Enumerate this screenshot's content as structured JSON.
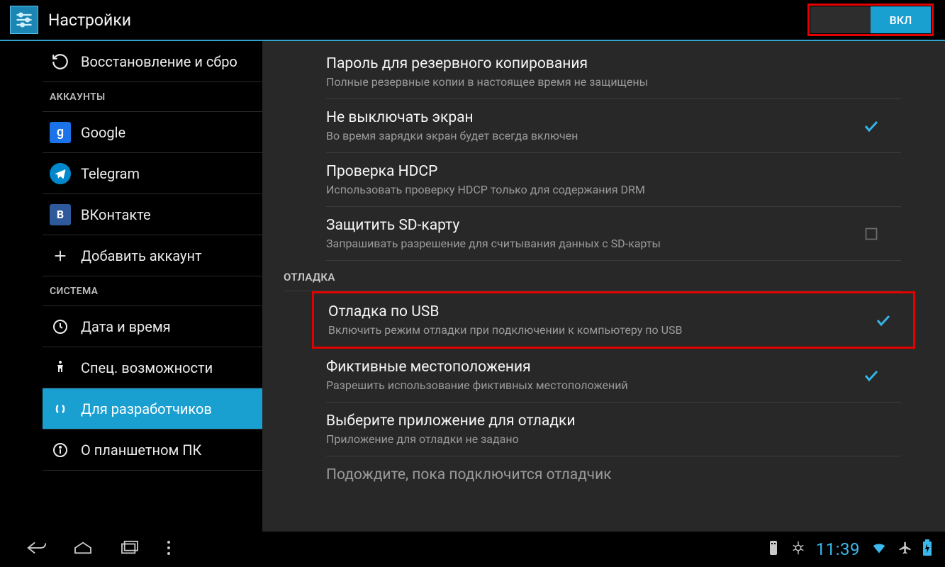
{
  "header": {
    "title": "Настройки",
    "toggle_label": "ВКЛ"
  },
  "sidebar": {
    "items": {
      "recovery": {
        "label": "Восстановление и сбро"
      },
      "google": {
        "label": "Google"
      },
      "telegram": {
        "label": "Telegram"
      },
      "vk": {
        "label": "ВКонтакте"
      },
      "add_account": {
        "label": "Добавить аккаунт"
      },
      "datetime": {
        "label": "Дата и время"
      },
      "accessibility": {
        "label": "Спец. возможности"
      },
      "developer": {
        "label": "Для разработчиков"
      },
      "about": {
        "label": "О планшетном ПК"
      }
    },
    "cat_accounts": "АККАУНТЫ",
    "cat_system": "СИСТЕМА"
  },
  "main": {
    "sec_debug": "ОТЛАДКА",
    "opt_backup_pw": {
      "title": "Пароль для резервного копирования",
      "sub": "Полные резервные копии в настоящее время не защищены"
    },
    "opt_stay_awake": {
      "title": "Не выключать экран",
      "sub": "Во время зарядки экран будет всегда включен"
    },
    "opt_hdcp": {
      "title": "Проверка HDCP",
      "sub": "Использовать проверку HDCP только для содержания DRM"
    },
    "opt_sd": {
      "title": "Защитить SD-карту",
      "sub": "Запрашивать разрешение для считывания данных с SD-карты"
    },
    "opt_usb_debug": {
      "title": "Отладка по USB",
      "sub": "Включить режим отладки при подключении к компьютеру по USB"
    },
    "opt_mock_loc": {
      "title": "Фиктивные местоположения",
      "sub": "Разрешить использование фиктивных местоположений"
    },
    "opt_dbg_app": {
      "title": "Выберите приложение для отладки",
      "sub": "Приложение для отладки не задано"
    },
    "opt_wait_dbg": {
      "title": "Подождите, пока подключится отладчик",
      "sub": ""
    }
  },
  "statusbar": {
    "clock": "11:39"
  }
}
